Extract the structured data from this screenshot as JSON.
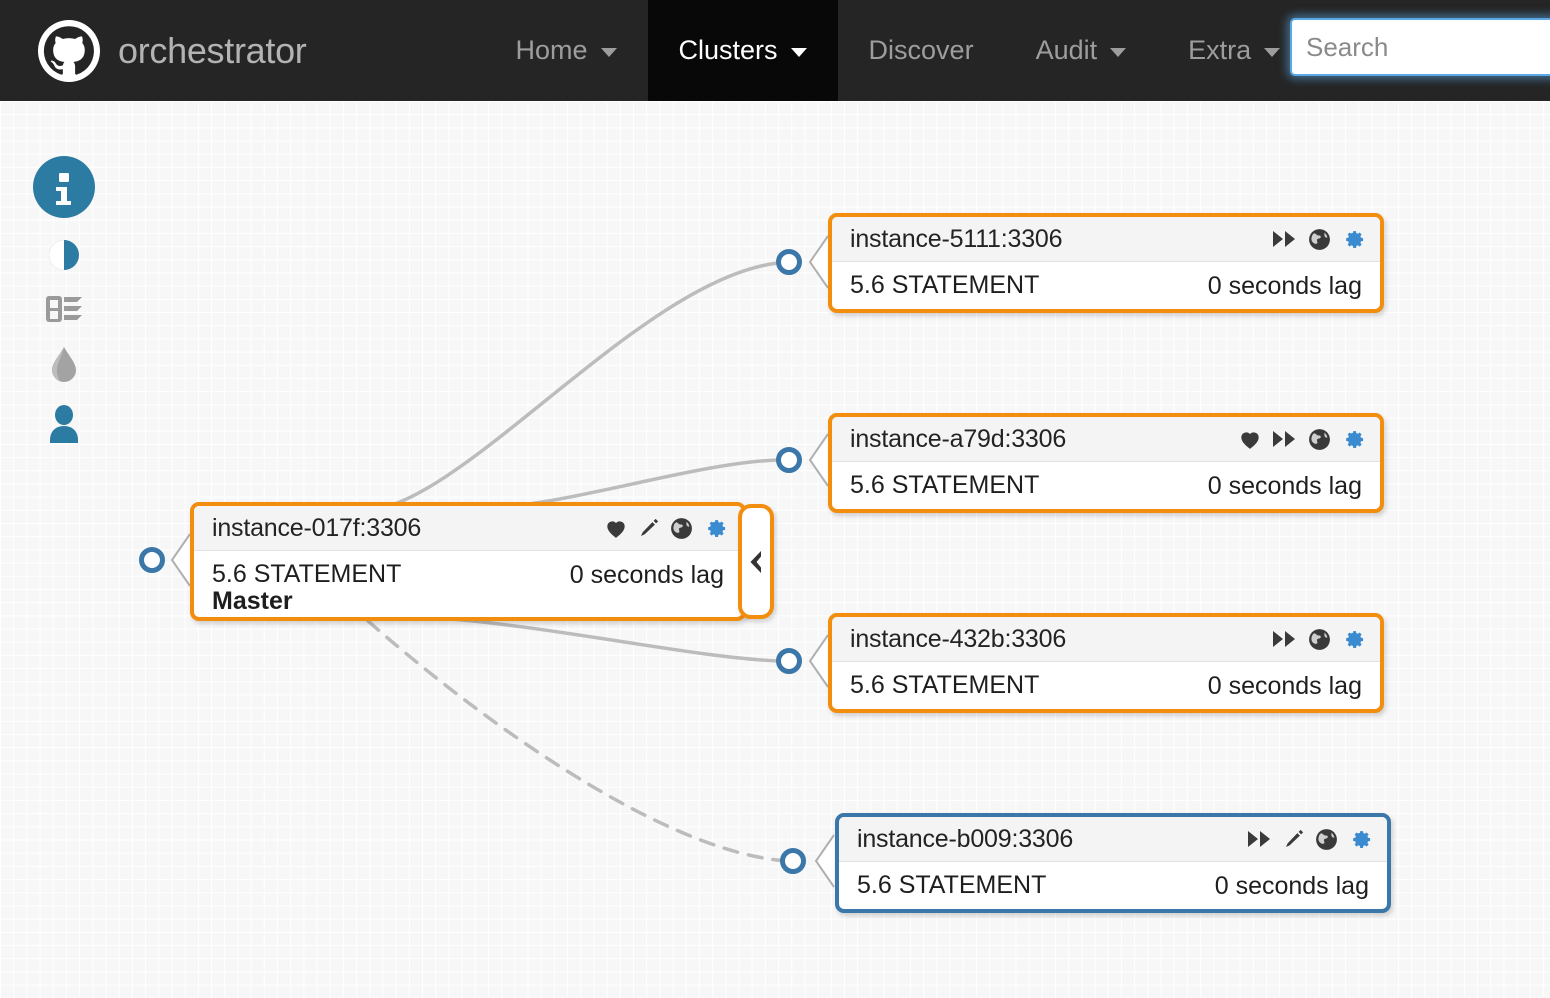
{
  "app": {
    "brand": "orchestrator",
    "logo_icon": "github-octocat-icon"
  },
  "nav": {
    "items": [
      {
        "label": "Home",
        "has_caret": true,
        "active": false
      },
      {
        "label": "Clusters",
        "has_caret": true,
        "active": true
      },
      {
        "label": "Discover",
        "has_caret": false,
        "active": false
      },
      {
        "label": "Audit",
        "has_caret": true,
        "active": false
      },
      {
        "label": "Extra",
        "has_caret": true,
        "active": false
      }
    ]
  },
  "search": {
    "placeholder": "Search",
    "value": "",
    "focused": true
  },
  "rail": {
    "items": [
      {
        "icon": "info-circle-icon",
        "label": "Information",
        "active": true
      },
      {
        "icon": "half-contrast-icon",
        "label": "Compact display",
        "active": false
      },
      {
        "icon": "database-list-icon",
        "label": "Instance details",
        "active": false
      },
      {
        "icon": "droplet-icon",
        "label": "Pool",
        "active": false
      },
      {
        "icon": "user-icon",
        "label": "User",
        "active": false
      }
    ]
  },
  "topology": {
    "collapse_toggle": {
      "icon": "chevron-left-icon",
      "label": "Collapse"
    },
    "colors": {
      "orange_border": "#f28d0d",
      "blue_border": "#3b77a8",
      "gear_blue": "#3b8bd0",
      "edge_gray": "#bcbcbc",
      "anchor_blue": "#3b77a8",
      "canvas_bg": "#f7f7f7"
    },
    "nodes": [
      {
        "id": "master",
        "title": "instance-017f:3306",
        "version": "5.6 STATEMENT",
        "role": "Master",
        "lag": "0 seconds lag",
        "border": "orange",
        "icons": [
          "heart-icon",
          "pencil-icon",
          "globe-icon",
          "gear-icon"
        ]
      },
      {
        "id": "5111",
        "title": "instance-5111:3306",
        "version": "5.6 STATEMENT",
        "role": "",
        "lag": "0 seconds lag",
        "border": "orange",
        "icons": [
          "fast-forward-icon",
          "globe-icon",
          "gear-icon"
        ]
      },
      {
        "id": "a79d",
        "title": "instance-a79d:3306",
        "version": "5.6 STATEMENT",
        "role": "",
        "lag": "0 seconds lag",
        "border": "orange",
        "icons": [
          "heart-icon",
          "fast-forward-icon",
          "globe-icon",
          "gear-icon"
        ]
      },
      {
        "id": "432b",
        "title": "instance-432b:3306",
        "version": "5.6 STATEMENT",
        "role": "",
        "lag": "0 seconds lag",
        "border": "orange",
        "icons": [
          "fast-forward-icon",
          "globe-icon",
          "gear-icon"
        ]
      },
      {
        "id": "b009",
        "title": "instance-b009:3306",
        "version": "5.6 STATEMENT",
        "role": "",
        "lag": "0 seconds lag",
        "border": "blue",
        "icons": [
          "fast-forward-icon",
          "pencil-icon",
          "globe-icon",
          "gear-icon"
        ]
      }
    ],
    "edges": [
      {
        "from": "master",
        "to": "5111",
        "style": "solid"
      },
      {
        "from": "master",
        "to": "a79d",
        "style": "solid"
      },
      {
        "from": "master",
        "to": "432b",
        "style": "solid"
      },
      {
        "from": "master",
        "to": "b009",
        "style": "dashed"
      }
    ]
  }
}
